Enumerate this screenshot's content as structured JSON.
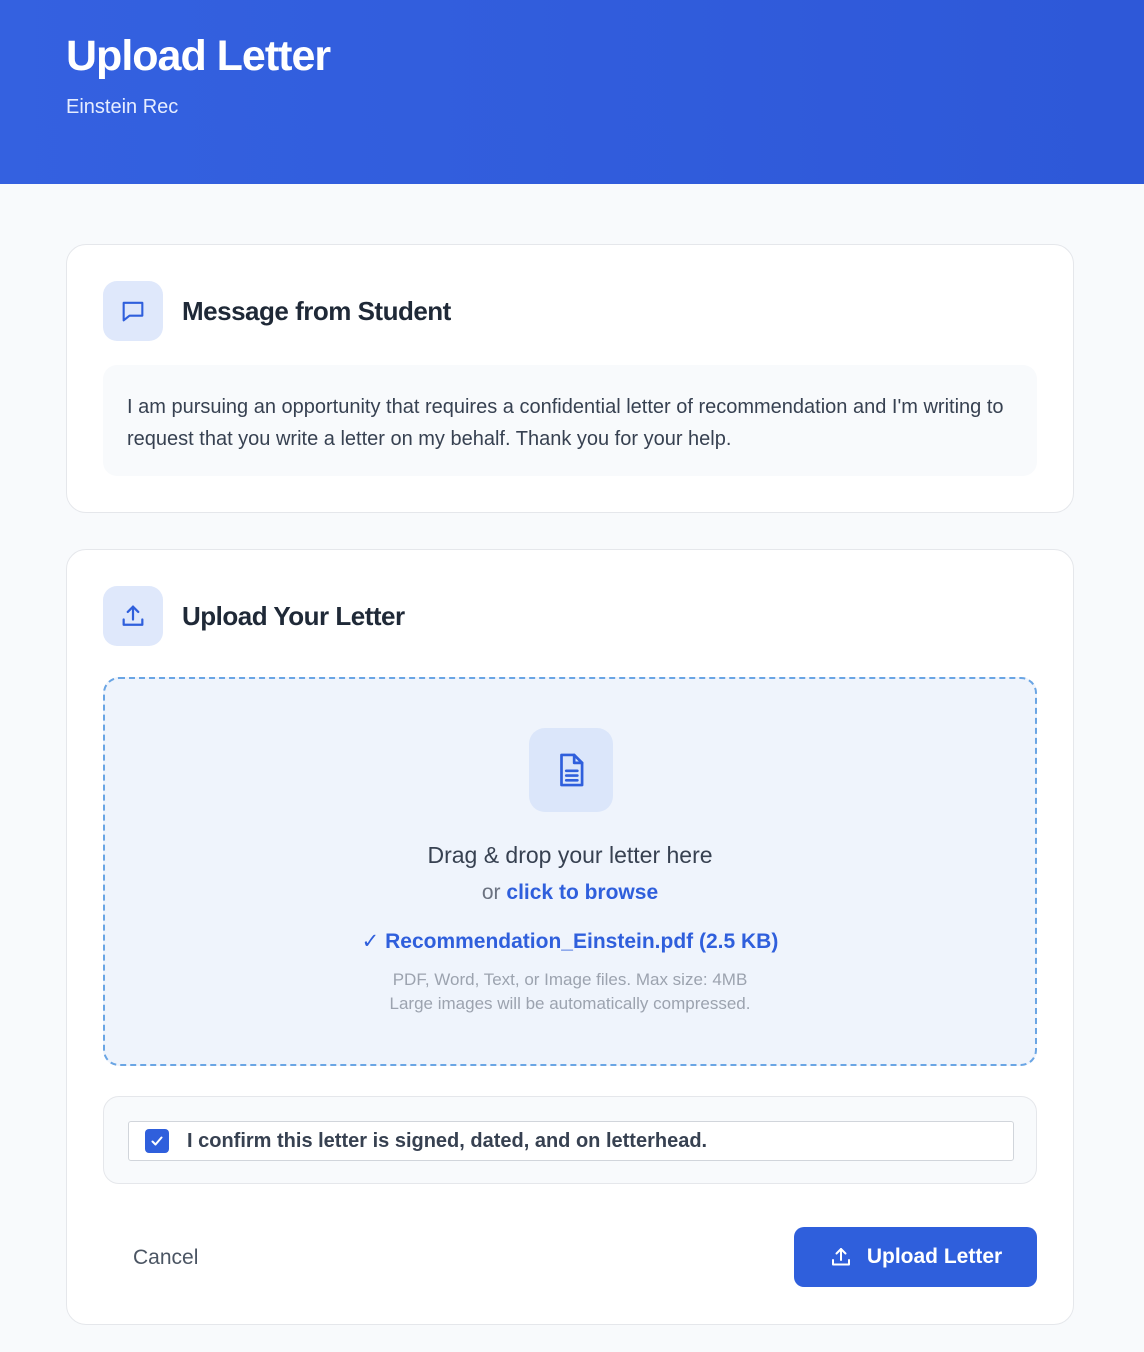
{
  "header": {
    "title": "Upload Letter",
    "subtitle": "Einstein Rec"
  },
  "message_card": {
    "title": "Message from Student",
    "icon": "chat-bubble-icon",
    "body": "I am pursuing an opportunity that requires a confidential letter of recommendation and I'm writing to request that you write a letter on my behalf. Thank you for your help."
  },
  "upload_card": {
    "title": "Upload Your Letter",
    "icon": "upload-icon",
    "dropzone": {
      "icon": "document-icon",
      "main_text": "Drag & drop your letter here",
      "or_text": "or",
      "browse_text": "click to browse",
      "file_selected": "✓ Recommendation_Einstein.pdf (2.5 KB)",
      "hint_line1": "PDF, Word, Text, or Image files. Max size: 4MB",
      "hint_line2": "Large images will be automatically compressed."
    },
    "confirm": {
      "checked": true,
      "label": "I confirm this letter is signed, dated, and on letterhead."
    },
    "cancel_label": "Cancel",
    "submit_label": "Upload Letter"
  },
  "colors": {
    "primary": "#2f5fdc",
    "header_bg": "#3461e0",
    "page_bg": "#f8fafc"
  }
}
